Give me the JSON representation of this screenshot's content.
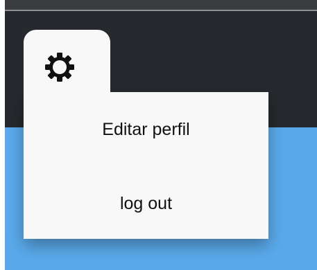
{
  "icons": {
    "settings": "gear-icon"
  },
  "colors": {
    "header_background": "#26292d",
    "content_background": "#5aaaeb",
    "menu_background": "#f8f8f8",
    "menu_text": "#111111"
  },
  "menu": {
    "items": [
      {
        "label": "Editar perfil"
      },
      {
        "label": "log out"
      }
    ]
  }
}
